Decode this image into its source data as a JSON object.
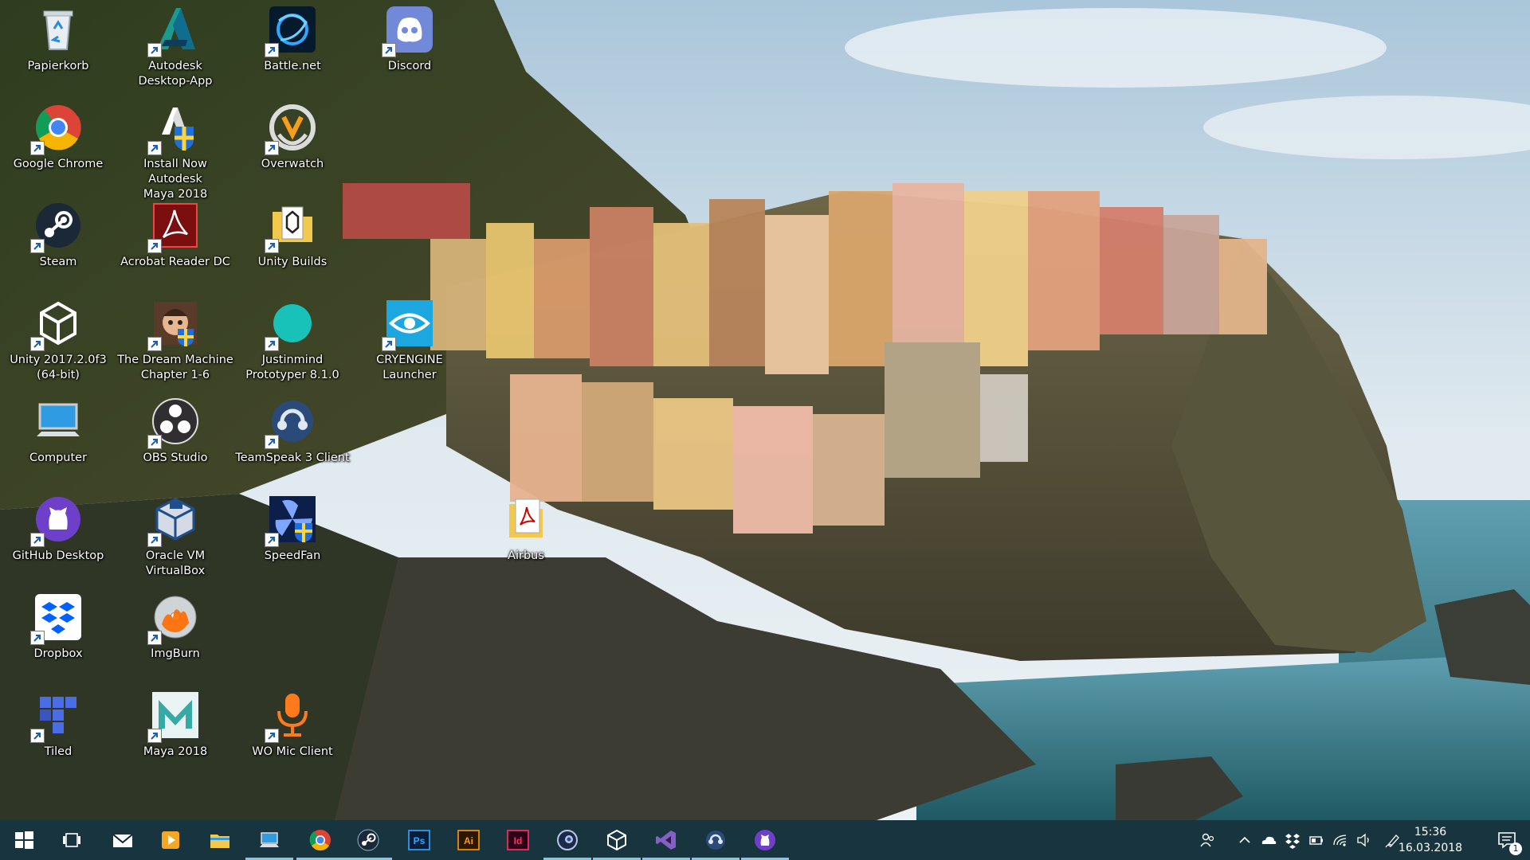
{
  "desktop": {
    "icons": [
      {
        "label": "Papierkorb",
        "icon": "recycle-bin-icon"
      },
      {
        "label": "Autodesk\nDesktop-App",
        "icon": "autodesk-icon"
      },
      {
        "label": "Battle.net",
        "icon": "battlenet-icon"
      },
      {
        "label": "Discord",
        "icon": "discord-icon"
      },
      {
        "label": "Google Chrome",
        "icon": "chrome-icon"
      },
      {
        "label": "Install Now Autodesk\nMaya 2018",
        "icon": "autodesk-installer-icon"
      },
      {
        "label": "Overwatch",
        "icon": "overwatch-icon"
      },
      {
        "label": "Steam",
        "icon": "steam-icon"
      },
      {
        "label": "Acrobat Reader DC",
        "icon": "acrobat-icon"
      },
      {
        "label": "Unity Builds",
        "icon": "folder-icon"
      },
      {
        "label": "Unity 2017.2.0f3\n(64-bit)",
        "icon": "unity-icon"
      },
      {
        "label": "The Dream Machine\nChapter 1-6",
        "icon": "dream-machine-icon"
      },
      {
        "label": "Justinmind\nPrototyper 8.1.0",
        "icon": "justinmind-icon"
      },
      {
        "label": "CRYENGINE Launcher",
        "icon": "cryengine-icon"
      },
      {
        "label": "Computer",
        "icon": "computer-icon"
      },
      {
        "label": "OBS Studio",
        "icon": "obs-icon"
      },
      {
        "label": "TeamSpeak 3 Client",
        "icon": "teamspeak-icon"
      },
      {
        "label": "GitHub Desktop",
        "icon": "github-icon"
      },
      {
        "label": "Oracle VM VirtualBox",
        "icon": "virtualbox-icon"
      },
      {
        "label": "SpeedFan",
        "icon": "speedfan-icon"
      },
      {
        "label": "Airbus",
        "icon": "pdf-file-icon"
      },
      {
        "label": "Dropbox",
        "icon": "dropbox-icon"
      },
      {
        "label": "ImgBurn",
        "icon": "imgburn-icon"
      },
      {
        "label": "Tiled",
        "icon": "tiled-icon"
      },
      {
        "label": "Maya 2018",
        "icon": "maya-icon"
      },
      {
        "label": "WO Mic Client",
        "icon": "microphone-icon"
      }
    ]
  },
  "taskbar": {
    "apps": [
      {
        "icon": "windows-start-icon"
      },
      {
        "icon": "task-view-icon"
      },
      {
        "icon": "mail-icon"
      },
      {
        "icon": "media-player-icon"
      },
      {
        "icon": "file-explorer-icon"
      },
      {
        "icon": "this-pc-icon"
      },
      {
        "icon": "chrome-icon"
      },
      {
        "icon": "steam-icon"
      },
      {
        "icon": "photoshop-icon",
        "text": "Ps"
      },
      {
        "icon": "illustrator-icon",
        "text": "Ai"
      },
      {
        "icon": "indesign-icon",
        "text": "Id"
      },
      {
        "icon": "blender-icon"
      },
      {
        "icon": "unity-icon"
      },
      {
        "icon": "visual-studio-icon"
      },
      {
        "icon": "teamspeak-icon"
      },
      {
        "icon": "github-icon"
      }
    ],
    "tray": {
      "icons": [
        "people-icon",
        "chevron-up-icon",
        "onedrive-icon",
        "dropbox-icon",
        "battery-icon",
        "wifi-icon",
        "volume-icon",
        "pen-icon"
      ],
      "time": "15:36",
      "date": "16.03.2018",
      "notification_count": "1"
    }
  },
  "colors": {
    "taskbar": "#08262f",
    "accent": "#7ec8e3"
  }
}
